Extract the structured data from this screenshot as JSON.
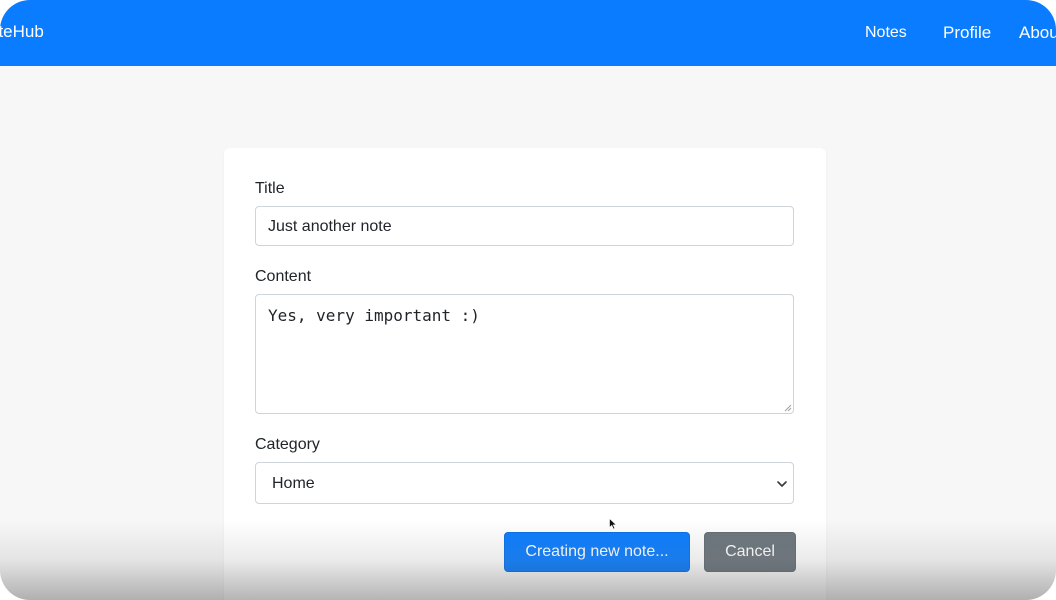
{
  "navbar": {
    "brand": "oteHub",
    "links": [
      {
        "label": "Notes"
      },
      {
        "label": "Profile"
      },
      {
        "label": "Abou"
      }
    ],
    "color": "#0a7cff"
  },
  "form": {
    "title_label": "Title",
    "title_value": "Just another note",
    "content_label": "Content",
    "content_value": "Yes, very important :)",
    "category_label": "Category",
    "category_selected": "Home",
    "submit_label": "Creating new note...",
    "cancel_label": "Cancel"
  },
  "icons": {
    "select_chevron": "chevron-down-icon",
    "resize_handle": "resize-grip-icon",
    "pointer": "mouse-cursor-icon"
  },
  "colors": {
    "primary": "#0a7cff",
    "secondary": "#6c757d",
    "background": "#f7f7f8"
  }
}
